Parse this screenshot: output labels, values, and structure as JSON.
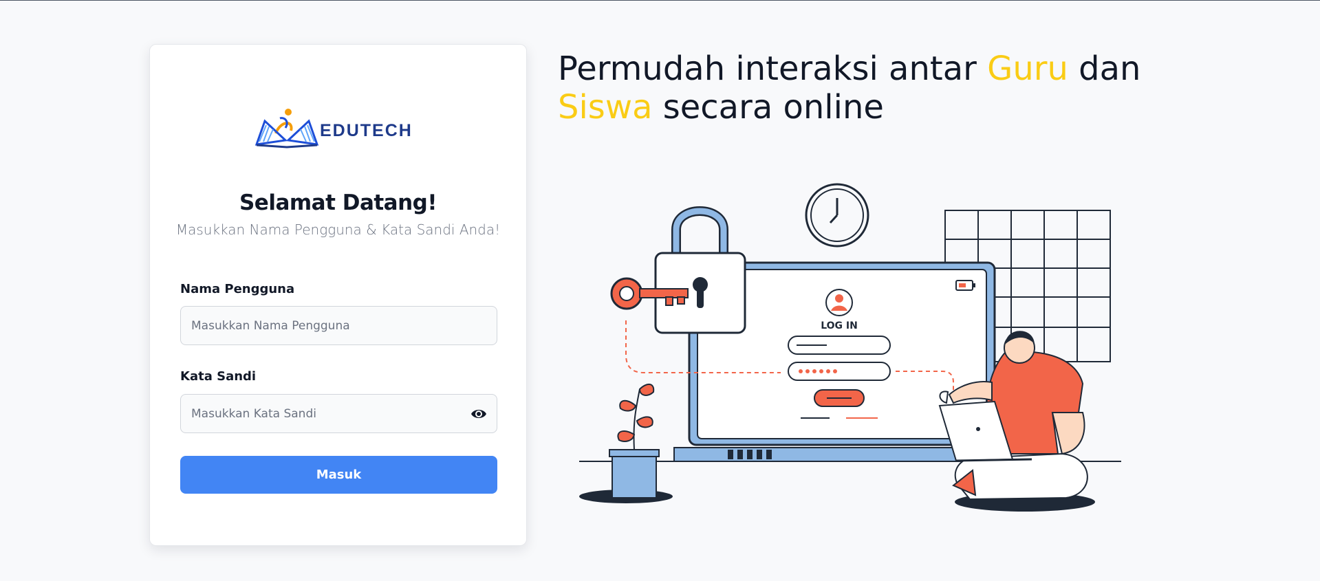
{
  "brand": {
    "name": "EDUTECH"
  },
  "login_card": {
    "title": "Selamat Datang!",
    "subtitle": "Masukkan Nama Pengguna & Kata Sandi Anda!",
    "username": {
      "label": "Nama Pengguna",
      "placeholder": "Masukkan Nama Pengguna",
      "value": ""
    },
    "password": {
      "label": "Kata Sandi",
      "placeholder": "Masukkan Kata Sandi",
      "value": "",
      "toggle_icon": "eye-icon"
    },
    "submit_label": "Masuk"
  },
  "hero": {
    "line1_part1": "Permudah interaksi antar ",
    "line1_highlight": "Guru",
    "line1_part2": " dan",
    "line2_highlight": "Siswa",
    "line2_part2": " secara online",
    "illustration_text": "LOG IN"
  },
  "colors": {
    "background": "#f8f9fb",
    "primary_button": "#4285f4",
    "highlight": "#facc15",
    "brand_navy": "#1e3a8a",
    "accent_red": "#f26549",
    "accent_blue": "#8fb8e4"
  }
}
